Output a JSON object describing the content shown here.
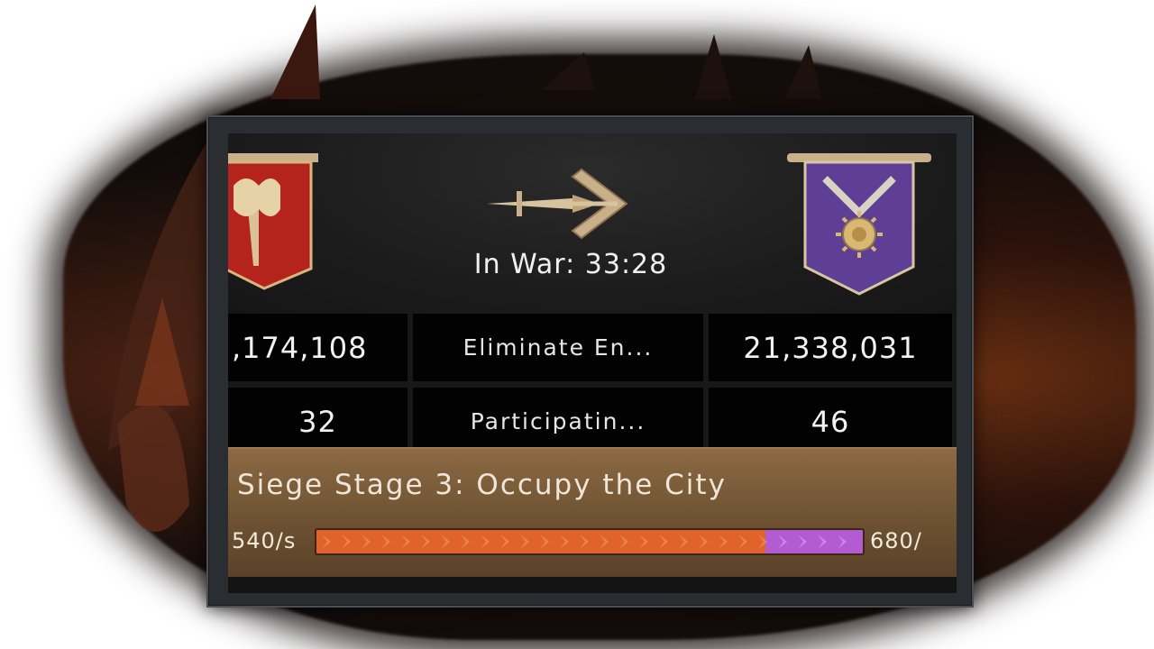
{
  "war": {
    "status_label": "In War:",
    "timer": "33:28"
  },
  "stats": [
    {
      "left": ",174,108",
      "label": "Eliminate En...",
      "right": "21,338,031"
    },
    {
      "left": "32",
      "label": "Participatin...",
      "right": "46"
    }
  ],
  "siege": {
    "title": "Siege Stage 3: Occupy the City",
    "left_rate": "540/s",
    "right_rate": "680/",
    "progress": {
      "left_share": 0.822,
      "right_share": 0.178
    }
  },
  "colors": {
    "left_team": "#e0632b",
    "right_team": "#b35bd1",
    "left_banner": "#b5231d",
    "right_banner": "#5f3e95"
  },
  "icons": {
    "left_banner": "red-axe-banner-icon",
    "right_banner": "purple-chevron-sun-banner-icon",
    "war": "crossed-sword-arrow-icon"
  }
}
